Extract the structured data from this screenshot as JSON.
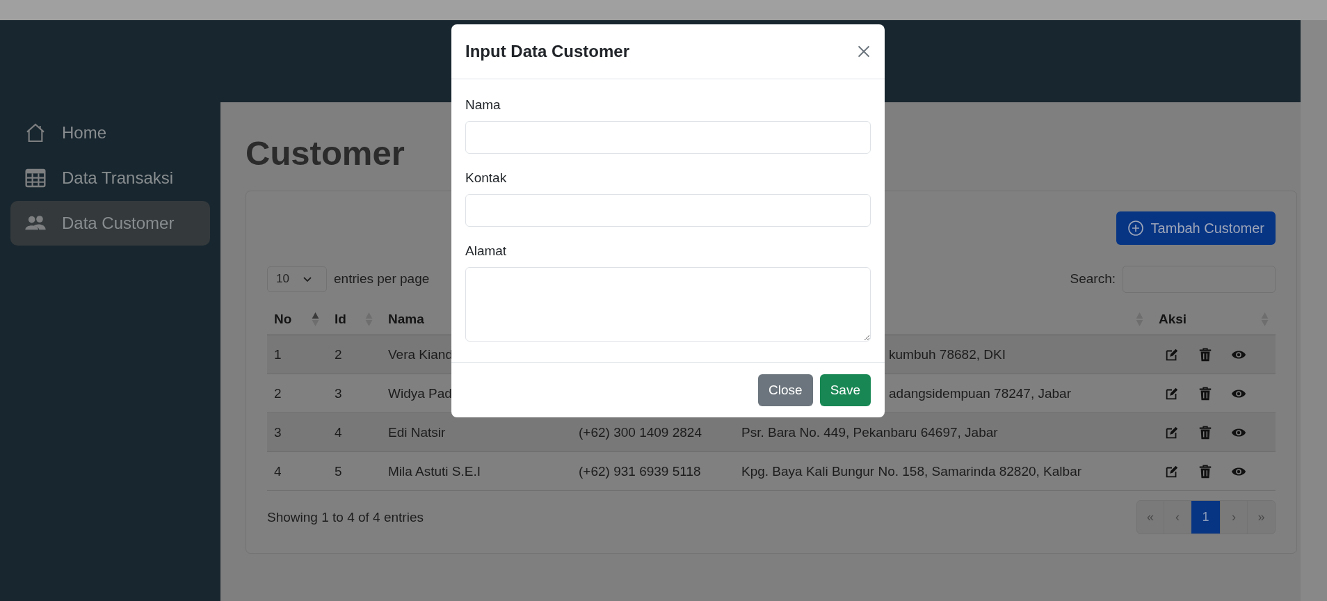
{
  "sidebar": {
    "items": [
      {
        "label": "Home",
        "selected": false
      },
      {
        "label": "Data Transaksi",
        "selected": false
      },
      {
        "label": "Data Customer",
        "selected": true
      }
    ]
  },
  "page": {
    "title": "Customer"
  },
  "card": {
    "add_button": "Tambah Customer",
    "entries": {
      "value": "10",
      "label": "entries per page"
    },
    "search": {
      "label": "Search:"
    },
    "table": {
      "columns": [
        {
          "label": "No",
          "sorted": true
        },
        {
          "label": "Id",
          "sorted": false
        },
        {
          "label": "Nama"
        },
        {},
        {
          "sorted": false
        },
        {
          "label": "Aksi",
          "sorted": false
        }
      ],
      "rows": [
        {
          "cells": [
            "1",
            "2",
            "Vera Kiand",
            null,
            {
              "text": "kumbuh 78682, DKI",
              "cut_start": true
            }
          ]
        },
        {
          "cells": [
            "2",
            "3",
            "Widya Pad",
            null,
            {
              "text": "adangsidempuan 78247, Jabar",
              "cut_start": true
            }
          ]
        },
        {
          "cells": [
            "3",
            "4",
            "Edi Natsir",
            "(+62) 300 1409 2824",
            "Psr. Bara No. 449, Pekanbaru 64697, Jabar"
          ]
        },
        {
          "cells": [
            "4",
            "5",
            "Mila Astuti S.E.I",
            "(+62) 931 6939 5118",
            "Kpg. Baya Kali Bungur No. 158, Samarinda 82820, Kalbar"
          ]
        }
      ]
    },
    "info": "Showing 1 to 4 of 4 entries",
    "pagination": [
      {
        "label": "«",
        "selected": false
      },
      {
        "label": "‹",
        "selected": false
      },
      {
        "label": "1",
        "selected": true
      },
      {
        "label": "›",
        "selected": false
      },
      {
        "label": "»",
        "selected": false
      }
    ]
  },
  "modal": {
    "title": "Input Data Customer",
    "fields": [
      {
        "label": "Nama",
        "kind": "input"
      },
      {
        "label": "Kontak",
        "kind": "input"
      },
      {
        "label": "Alamat",
        "kind": "textarea"
      }
    ],
    "buttons": [
      {
        "label": "Close",
        "kind": "secondary"
      },
      {
        "label": "Save",
        "kind": "primary"
      }
    ]
  }
}
